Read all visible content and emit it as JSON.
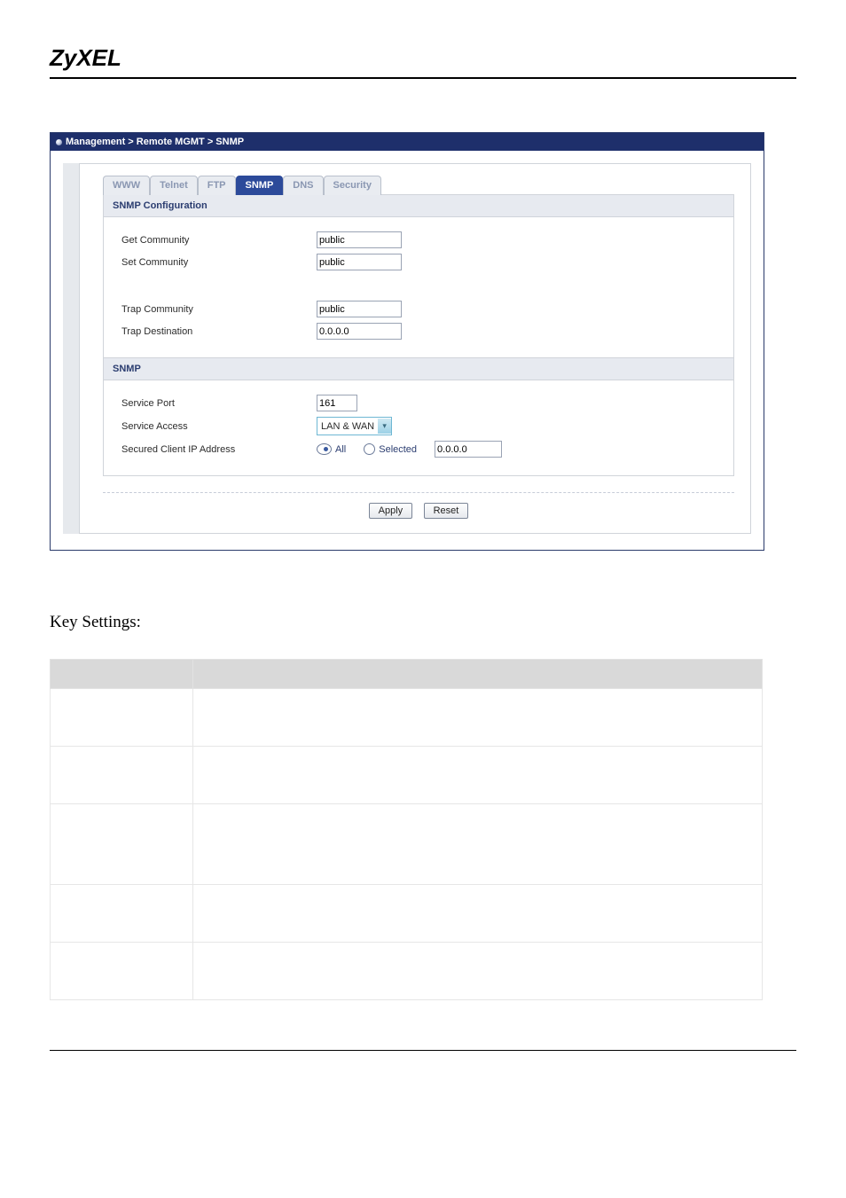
{
  "brand": "ZyXEL",
  "breadcrumb": "Management > Remote MGMT > SNMP",
  "tabs": {
    "www": "WWW",
    "telnet": "Telnet",
    "ftp": "FTP",
    "snmp": "SNMP",
    "dns": "DNS",
    "security": "Security"
  },
  "section1": {
    "title": "SNMP Configuration",
    "get_community_label": "Get Community",
    "get_community_value": "public",
    "set_community_label": "Set Community",
    "set_community_value": "public",
    "trap_community_label": "Trap  Community",
    "trap_community_value": "public",
    "trap_destination_label": "Trap  Destination",
    "trap_destination_value": "0.0.0.0"
  },
  "section2": {
    "title": "SNMP",
    "service_port_label": "Service Port",
    "service_port_value": "161",
    "service_access_label": "Service Access",
    "service_access_value": "LAN & WAN",
    "secured_ip_label": "Secured Client IP Address",
    "radio_all": "All",
    "radio_selected": "Selected",
    "secured_ip_value": "0.0.0.0"
  },
  "buttons": {
    "apply": "Apply",
    "reset": "Reset"
  },
  "key_heading": "Key Settings:",
  "key_table": {
    "headers": [
      "",
      ""
    ],
    "rows": [
      [
        "",
        ""
      ],
      [
        "",
        ""
      ],
      [
        "",
        ""
      ],
      [
        "",
        ""
      ],
      [
        "",
        ""
      ]
    ]
  }
}
